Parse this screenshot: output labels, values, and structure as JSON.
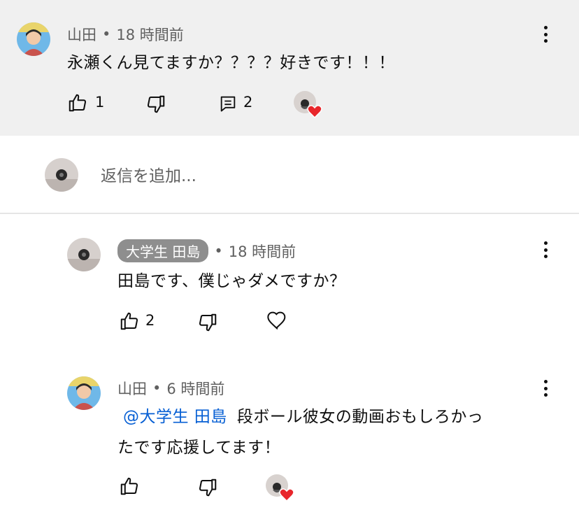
{
  "colors": {
    "parent_bg": "#f0f0f0",
    "mention": "#065fd4",
    "chip_bg": "#8e8e8e",
    "heart": "#e8262b"
  },
  "parent_comment": {
    "author": "山田",
    "time": "18 時間前",
    "text": "永瀬くん見てますか？？？？好きです！！！",
    "like_count": "1",
    "reply_count": "2",
    "hearted_by_creator": true
  },
  "reply_box": {
    "placeholder": "返信を追加..."
  },
  "replies": [
    {
      "author": "大学生 田島",
      "time": "18 時間前",
      "text": "田島です、僕じゃダメですか？",
      "like_count": "2",
      "author_is_creator": true
    },
    {
      "author": "山田",
      "time": "6 時間前",
      "mention": "@大学生 田島",
      "text_line1": "段ボール彼女の動画おもしろかっ",
      "text_line2": "たです応援してます！",
      "hearted_by_creator": true
    }
  ],
  "separator": "•",
  "icons": [
    "thumbs-up-icon",
    "thumbs-down-icon",
    "reply-icon",
    "heart-icon",
    "more-vert-icon"
  ]
}
